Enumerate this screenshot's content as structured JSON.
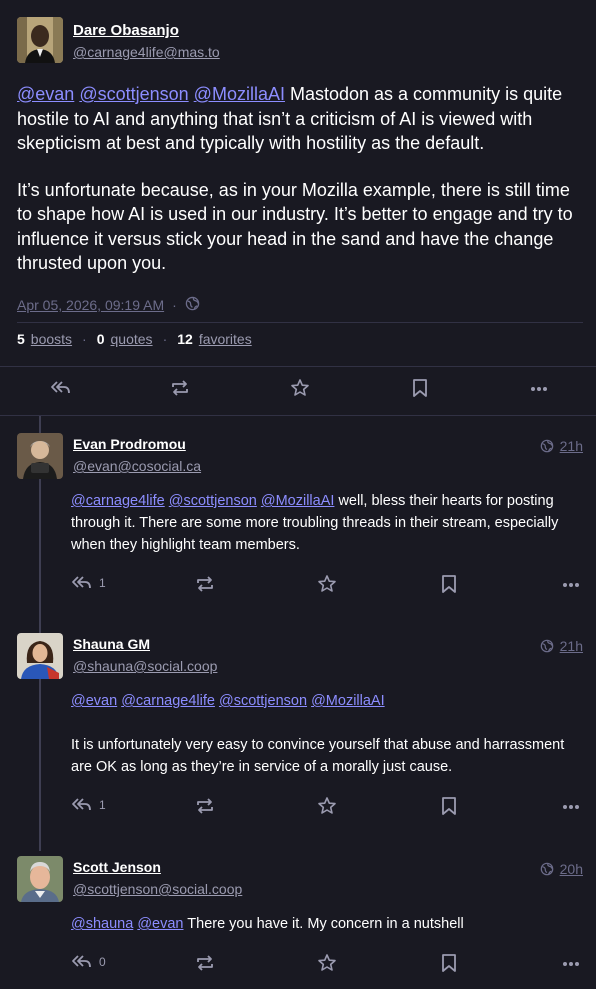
{
  "focal": {
    "author_name": "Dare Obasanjo",
    "author_handle": "@carnage4life@mas.to",
    "mentions": [
      "@evan",
      "@scottjenson",
      "@MozillaAI"
    ],
    "paragraph1_rest": " Mastodon as a community is quite hostile to AI and anything that isn’t a criticism of AI is viewed with skepticism at best and typically with hostility as the default.",
    "paragraph2": "It’s unfortunate because, as in your Mozilla example, there is still time to shape how AI is used in our industry. It’s better to engage and try to influence it versus stick your head in the sand and have the change thrusted upon you.",
    "date": "Apr 05, 2026, 09:19 AM",
    "meta_separator": "·",
    "visibility_icon": "globe-icon",
    "boosts_count": "5",
    "boosts_label": "boosts",
    "quotes_count": "0",
    "quotes_label": "quotes",
    "favorites_count": "12",
    "favorites_label": "favorites",
    "stat_separator": "·"
  },
  "replies": [
    {
      "author_name": "Evan Prodromou",
      "author_handle": "@evan@cosocial.ca",
      "time": "21h",
      "mentions": [
        "@carnage4life",
        "@scottjenson",
        "@MozillaAI"
      ],
      "text": " well, bless their hearts for posting through it. There are some more troubling threads in their stream, especially when they highlight team members.",
      "reply_count": "1"
    },
    {
      "author_name": "Shauna GM",
      "author_handle": "@shauna@social.coop",
      "time": "21h",
      "mentions": [
        "@evan",
        "@carnage4life",
        "@scottjenson",
        "@MozillaAI"
      ],
      "text": "It is unfortunately very easy to convince yourself that abuse and harrassment are OK as long as they’re in service of a morally just cause.",
      "reply_count": "1"
    },
    {
      "author_name": "Scott Jenson",
      "author_handle": "@scottjenson@social.coop",
      "time": "20h",
      "mentions": [
        "@shauna",
        "@evan"
      ],
      "text": " There you have it. My concern in a nutshell",
      "reply_count": "0"
    }
  ],
  "colors": {
    "background": "#191922",
    "accent_link": "#8c8dff",
    "muted": "#9b9bb0",
    "divider": "#313144"
  }
}
